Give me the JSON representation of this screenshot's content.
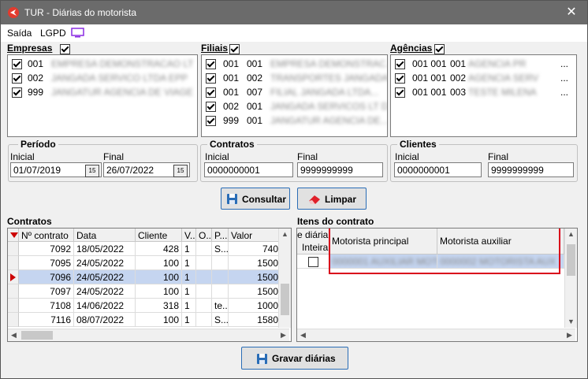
{
  "window": {
    "title": "TUR - Diárias do motorista",
    "close": "✕"
  },
  "menu": {
    "saida": "Saída",
    "lgpd": "LGPD"
  },
  "empresas": {
    "label": "Empresas",
    "items": [
      {
        "code": "001",
        "name": "EMPRESA DEMONSTRACAO LT"
      },
      {
        "code": "002",
        "name": "JANGADA SERVICO LTDA EPP"
      },
      {
        "code": "999",
        "name": "JANGATUR AGENCIA DE VIAGE"
      }
    ]
  },
  "filiais": {
    "label": "Filiais",
    "items": [
      {
        "c1": "001",
        "c2": "001",
        "name": "EMPRESA DEMONSTRAC..."
      },
      {
        "c1": "001",
        "c2": "002",
        "name": "TRANSPORTES JANGADA..."
      },
      {
        "c1": "001",
        "c2": "007",
        "name": "FILIAL JANGADA LTDA..."
      },
      {
        "c1": "002",
        "c2": "001",
        "name": "JANGADA SERVICOS LT D..."
      },
      {
        "c1": "999",
        "c2": "001",
        "name": "JANGATUR AGENCIA DE..."
      }
    ]
  },
  "agencias": {
    "label": "Agências",
    "items": [
      {
        "code": "001 001",
        "num": "001",
        "name": "AGENCIA PR",
        "tail": "..."
      },
      {
        "code": "001 001",
        "num": "002",
        "name": "AGENCIA SERV",
        "tail": "..."
      },
      {
        "code": "001 001",
        "num": "003",
        "name": "TESTE MILENA",
        "tail": "..."
      }
    ]
  },
  "periodo": {
    "label": "Período",
    "inicial_label": "Inicial",
    "final_label": "Final",
    "inicial": "01/07/2019",
    "final": "26/07/2022",
    "cal": "15"
  },
  "contratos_range": {
    "label": "Contratos",
    "inicial_label": "Inicial",
    "final_label": "Final",
    "inicial": "0000000001",
    "final": "9999999999"
  },
  "clientes_range": {
    "label": "Clientes",
    "inicial_label": "Inicial",
    "final_label": "Final",
    "inicial": "0000000001",
    "final": "9999999999"
  },
  "buttons": {
    "consultar": "Consultar",
    "limpar": "Limpar",
    "gravar": "Gravar diárias"
  },
  "contratos_grid": {
    "title": "Contratos",
    "columns": [
      "Nº contrato",
      "Data",
      "Cliente",
      "V...",
      "O...",
      "P...",
      "Valor"
    ],
    "rows": [
      {
        "num": "7092",
        "data": "18/05/2022",
        "cliente": "428",
        "v": "1",
        "o": "",
        "p": "S...",
        "valor": "740"
      },
      {
        "num": "7095",
        "data": "24/05/2022",
        "cliente": "100",
        "v": "1",
        "o": "",
        "p": "",
        "valor": "1500"
      },
      {
        "num": "7096",
        "data": "24/05/2022",
        "cliente": "100",
        "v": "1",
        "o": "",
        "p": "",
        "valor": "1500"
      },
      {
        "num": "7097",
        "data": "24/05/2022",
        "cliente": "100",
        "v": "1",
        "o": "",
        "p": "",
        "valor": "1500"
      },
      {
        "num": "7108",
        "data": "14/06/2022",
        "cliente": "318",
        "v": "1",
        "o": "",
        "p": "te...",
        "valor": "1000"
      },
      {
        "num": "7116",
        "data": "08/07/2022",
        "cliente": "100",
        "v": "1",
        "o": "",
        "p": "S...",
        "valor": "1580"
      }
    ],
    "selected_index": 2
  },
  "itens_grid": {
    "title": "Itens do contrato",
    "columns": {
      "diaria": "e diária",
      "inteira": "Inteira",
      "principal": "Motorista principal",
      "auxiliar": "Motorista auxiliar"
    },
    "row": {
      "principal": "0000001 AUXILIAR MOTORISTA",
      "auxiliar": "0000002 MOTORISTA AUX"
    }
  },
  "colors": {
    "highlight": "#d9001b",
    "selection": "#c5d5f0",
    "titlebar": "#6b6b6b",
    "accent": "#2a6db6"
  }
}
